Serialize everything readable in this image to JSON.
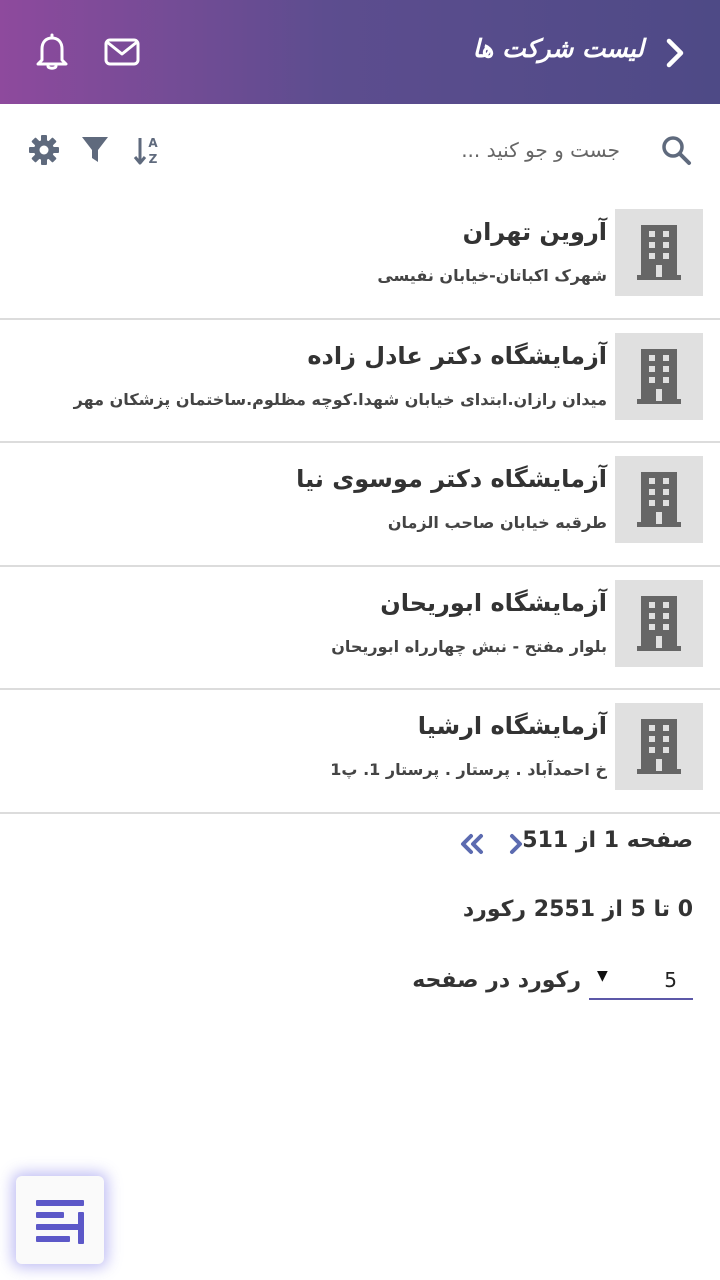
{
  "header": {
    "title": "لیست شرکت ها",
    "back_icon": "chevron-right-icon",
    "mail_icon": "mail-icon",
    "bell_icon": "bell-icon"
  },
  "toolbar": {
    "search_placeholder": "جست و جو کنید ...",
    "search_value": "",
    "search_icon": "search-icon",
    "sort_icon": "sort-az-icon",
    "filter_icon": "filter-icon",
    "settings_icon": "gear-icon"
  },
  "companies": [
    {
      "name": "آروین تهران",
      "address": "شهرک اکباتان-خیابان نفیسی"
    },
    {
      "name": "آزمایشگاه دکتر عادل زاده",
      "address": "میدان رازان.ابتدای خیابان شهدا.کوچه مظلوم.ساختمان پزشکان مهر"
    },
    {
      "name": "آزمایشگاه دکتر موسوی نیا",
      "address": "طرقبه خیابان صاحب الزمان"
    },
    {
      "name": "آزمایشگاه ابوریحان",
      "address": "بلوار مفتح - نبش چهارراه ابوریحان"
    },
    {
      "name": "آزمایشگاه ارشیا",
      "address": "خ احمدآباد . پرستار . پرستار 1. پ1"
    }
  ],
  "pagination": {
    "page_label": "صفحه 1 از 511",
    "records_label": "0 تا 5 از 2551 رکورد",
    "per_page_label": "رکورد در صفحه",
    "per_page_value": "5",
    "caret": "▼"
  },
  "colors": {
    "header_start": "#8e4a9d",
    "header_end": "#4e4a86",
    "icon_gray": "#5f6a7d",
    "accent": "#5c58a8"
  }
}
